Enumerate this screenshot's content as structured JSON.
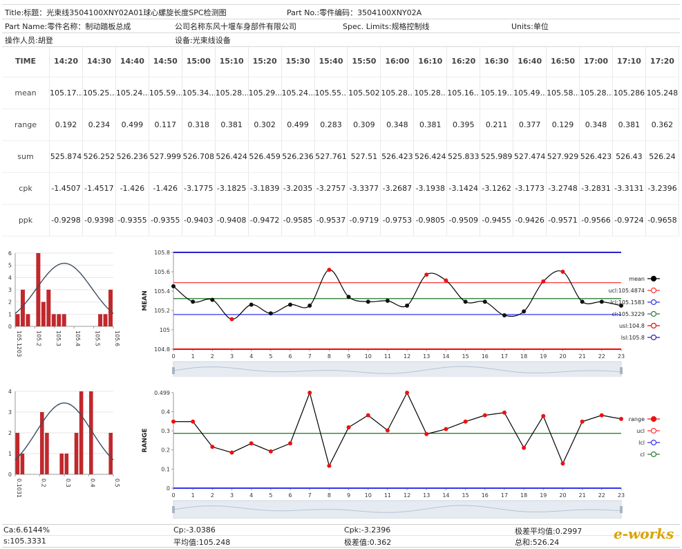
{
  "header": {
    "title": "Title:标题：光束线3504100XNY02A01球心螺旋长度SPC检测图",
    "part_no": "Part No.:零件编码：3504100XNY02A",
    "part_name": "Part Name:零件名称：制动踏板总成",
    "company": "公司名称东风十堰车身部件有限公司",
    "spec_limits": "Spec. Limits:规格控制线",
    "units": "Units:单位",
    "operator": "操作人员:胡登",
    "equipment": "设备:光束线设备"
  },
  "table": {
    "columns": [
      "TIME",
      "14:20",
      "14:30",
      "14:40",
      "14:50",
      "15:00",
      "15:10",
      "15:20",
      "15:30",
      "15:40",
      "15:50",
      "16:00",
      "16:10",
      "16:20",
      "16:30",
      "16:40",
      "16:50",
      "17:00",
      "17:10",
      "17:20"
    ],
    "rows": [
      {
        "label": "mean",
        "values": [
          "105.17...",
          "105.25...",
          "105.24...",
          "105.59...",
          "105.34...",
          "105.28...",
          "105.29...",
          "105.24...",
          "105.55...",
          "105.502",
          "105.28...",
          "105.28...",
          "105.16...",
          "105.19...",
          "105.49...",
          "105.58...",
          "105.28...",
          "105.286",
          "105.248"
        ]
      },
      {
        "label": "range",
        "values": [
          "0.192",
          "0.234",
          "0.499",
          "0.117",
          "0.318",
          "0.381",
          "0.302",
          "0.499",
          "0.283",
          "0.309",
          "0.348",
          "0.381",
          "0.395",
          "0.211",
          "0.377",
          "0.129",
          "0.348",
          "0.381",
          "0.362"
        ]
      },
      {
        "label": "sum",
        "values": [
          "525.874",
          "526.252",
          "526.236",
          "527.999",
          "526.708",
          "526.424",
          "526.459",
          "526.236",
          "527.761",
          "527.51",
          "526.423",
          "526.424",
          "525.833",
          "525.989",
          "527.474",
          "527.929",
          "526.423",
          "526.43",
          "526.24"
        ]
      },
      {
        "label": "cpk",
        "values": [
          "-1.4507",
          "-1.4517",
          "-1.426",
          "-1.426",
          "-3.1775",
          "-3.1825",
          "-3.1839",
          "-3.2035",
          "-3.2757",
          "-3.3377",
          "-3.2687",
          "-3.1938",
          "-3.1424",
          "-3.1262",
          "-3.1773",
          "-3.2748",
          "-3.2831",
          "-3.3131",
          "-3.2396"
        ]
      },
      {
        "label": "ppk",
        "values": [
          "-0.9298",
          "-0.9398",
          "-0.9355",
          "-0.9355",
          "-0.9403",
          "-0.9408",
          "-0.9472",
          "-0.9585",
          "-0.9537",
          "-0.9719",
          "-0.9753",
          "-0.9805",
          "-0.9509",
          "-0.9455",
          "-0.9426",
          "-0.9571",
          "-0.9566",
          "-0.9724",
          "-0.9658"
        ]
      }
    ]
  },
  "chart_data": [
    {
      "id": "mean_hist",
      "type": "bar",
      "title": "",
      "ylim": [
        0,
        6
      ],
      "yticks": [
        0,
        1,
        2,
        3,
        4,
        5,
        6
      ],
      "xticks": [
        "105.1203",
        "105.2",
        "105.3",
        "105.4",
        "105.5",
        "105.6"
      ],
      "values": [
        1,
        3,
        1,
        0,
        6,
        2,
        3,
        1,
        1,
        1,
        0,
        0,
        0,
        0,
        0,
        0,
        1,
        1,
        3
      ],
      "bar_color": "#c0282c",
      "curve_color": "#3d4b5c"
    },
    {
      "id": "mean_chart",
      "type": "line",
      "ylabel": "MEAN",
      "ylim": [
        104.8,
        105.8
      ],
      "yticks": [
        "104.8",
        "105",
        "105.2",
        "105.4",
        "105.6",
        "105.8"
      ],
      "x": [
        0,
        1,
        2,
        3,
        4,
        5,
        6,
        7,
        8,
        9,
        10,
        11,
        12,
        13,
        14,
        15,
        16,
        17,
        18,
        19,
        20,
        21,
        22,
        23
      ],
      "values": [
        105.45,
        105.29,
        105.31,
        105.11,
        105.26,
        105.17,
        105.26,
        105.25,
        105.62,
        105.34,
        105.29,
        105.3,
        105.25,
        105.57,
        105.51,
        105.29,
        105.29,
        105.15,
        105.19,
        105.5,
        105.6,
        105.29,
        105.29,
        105.25
      ],
      "point_colors": [
        "black",
        "black",
        "black",
        "red",
        "black",
        "black",
        "black",
        "black",
        "red",
        "black",
        "black",
        "black",
        "black",
        "red",
        "red",
        "black",
        "black",
        "black",
        "black",
        "red",
        "red",
        "black",
        "black",
        "black"
      ],
      "limits": [
        {
          "name": "ucl:105.4874",
          "value": 105.4874,
          "color": "#ff3333"
        },
        {
          "name": "lcl:105.1583",
          "value": 105.1583,
          "color": "#3333ee"
        },
        {
          "name": "cl:105.3229",
          "value": 105.3229,
          "color": "#2e7d32"
        },
        {
          "name": "usl:104.8",
          "value": 104.8,
          "color": "#ff0000"
        },
        {
          "name": "lsl:105.8",
          "value": 105.8,
          "color": "#2222cc"
        }
      ],
      "legend_main": "mean"
    },
    {
      "id": "range_hist",
      "type": "bar",
      "title": "",
      "ylim": [
        0,
        4
      ],
      "yticks": [
        0,
        1,
        2,
        3,
        4
      ],
      "xticks": [
        "0.1031",
        "0.2",
        "0.3",
        "0.4",
        "0.5"
      ],
      "values": [
        2,
        1,
        0,
        0,
        0,
        3,
        2,
        0,
        0,
        1,
        1,
        0,
        2,
        4,
        0,
        4,
        0,
        0,
        0,
        2
      ],
      "bar_color": "#c0282c",
      "curve_color": "#3d4b5c"
    },
    {
      "id": "range_chart",
      "type": "line",
      "ylabel": "RANGE",
      "ylim": [
        0,
        0.499
      ],
      "yticks": [
        "0",
        "0.1",
        "0.2",
        "0.3",
        "0.4",
        "0.499"
      ],
      "x": [
        0,
        1,
        2,
        3,
        4,
        5,
        6,
        7,
        8,
        9,
        10,
        11,
        12,
        13,
        14,
        15,
        16,
        17,
        18,
        19,
        20,
        21,
        22,
        23
      ],
      "values": [
        0.348,
        0.348,
        0.216,
        0.186,
        0.234,
        0.192,
        0.234,
        0.499,
        0.117,
        0.318,
        0.381,
        0.302,
        0.499,
        0.283,
        0.309,
        0.348,
        0.381,
        0.395,
        0.211,
        0.377,
        0.129,
        0.348,
        0.381,
        0.362
      ],
      "limits": [
        {
          "name": "ucl",
          "value": null,
          "color": "#ff3333"
        },
        {
          "name": "lcl",
          "value": 0.0,
          "color": "#3333ee"
        },
        {
          "name": "cl",
          "value": 0.2867,
          "color": "#2e7d32"
        }
      ],
      "legend_main": "range"
    }
  ],
  "footer": {
    "ca": "Ca:6.6144%",
    "cp": "Cp:-3.0386",
    "cpk": "Cpk:-3.2396",
    "range_avg": "极差平均值:0.2997",
    "s": "s:105.3331",
    "mean": "平均值:105.248",
    "range": "极差值:0.362",
    "sum": "总和:526.24"
  },
  "logo": "e-works"
}
